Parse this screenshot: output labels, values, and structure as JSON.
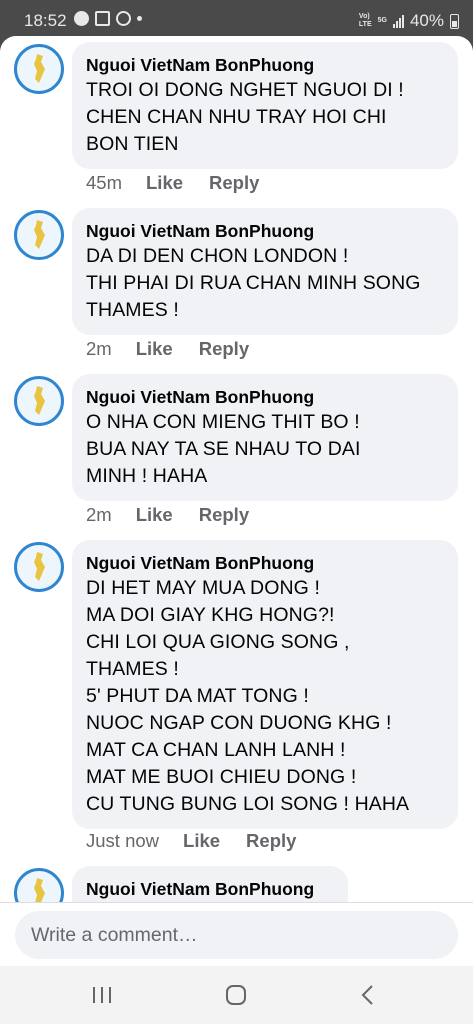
{
  "status_bar": {
    "time": "18:52",
    "left_icons": [
      "facebook-icon",
      "qr-code-icon",
      "sync-icon",
      "dot-icon"
    ],
    "network_volte": "Vo)",
    "network_lte": "LTE",
    "network_5g": "5G",
    "battery": "40%"
  },
  "comments": [
    {
      "author": "Nguoi VietNam BonPhuong",
      "text": "TROI OI DONG NGHET NGUOI DI !\nCHEN CHAN NHU TRAY HOI CHI\nBON TIEN",
      "time": "45m",
      "like": "Like",
      "reply": "Reply"
    },
    {
      "author": "Nguoi VietNam BonPhuong",
      "text": "DA DI DEN CHON LONDON !\nTHI PHAI DI RUA CHAN MINH SONG\nTHAMES !",
      "time": "2m",
      "like": "Like",
      "reply": "Reply"
    },
    {
      "author": "Nguoi VietNam BonPhuong",
      "text": "O NHA CON MIENG THIT BO !\nBUA NAY TA SE NHAU TO DAI\nMINH ! HAHA",
      "time": "2m",
      "like": "Like",
      "reply": "Reply"
    },
    {
      "author": "Nguoi VietNam BonPhuong",
      "text": "DI HET MAY MUA DONG !\nMA DOI GIAY KHG HONG?!\nCHI LOI QUA GIONG SONG ,\nTHAMES !\n5' PHUT DA MAT TONG !\nNUOC NGAP CON DUONG KHG !\nMAT CA CHAN LANH LANH !\nMAT ME BUOI CHIEU DONG !\nCU TUNG BUNG LOI SONG ! HAHA",
      "time": "Just now",
      "like": "Like",
      "reply": "Reply"
    },
    {
      "author": "Nguoi VietNam BonPhuong"
    }
  ],
  "composer": {
    "placeholder": "Write a comment…"
  },
  "nav_bar": {
    "buttons": [
      "recent-apps-icon",
      "home-icon",
      "back-icon"
    ]
  },
  "colors": {
    "bubble": "#f0f2f5",
    "meta_text": "#65676b",
    "text": "#050505",
    "avatar_ring": "#2f86d0",
    "status_bar_bg": "#4a4a4a"
  }
}
